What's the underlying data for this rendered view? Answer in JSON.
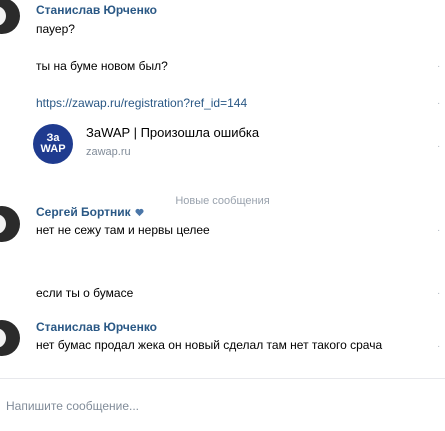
{
  "messages": {
    "m1": {
      "author": "Станислав Юрченко",
      "lines": [
        "пауер?",
        "ты на буме новом был?"
      ]
    },
    "link_url": "https://zawap.ru/registration?ref_id=144",
    "preview": {
      "logo_line1": "За",
      "logo_line2": "WAP",
      "title": "ЗаWAP | Произошла ошибка",
      "domain": "zawap.ru"
    },
    "divider": "Новые сообщения",
    "m2": {
      "author": "Сергей Бортник",
      "lines": [
        "нет не сежу там и нервы целее",
        "если ты о бумасе"
      ]
    },
    "m3": {
      "author": "Станислав Юрченко",
      "lines": [
        "нет бумас продал жека он новый сделал там нет такого срача"
      ]
    }
  },
  "input": {
    "placeholder": "Напишите сообщение..."
  },
  "colors": {
    "link": "#2a5885",
    "muted": "#818c99",
    "logo_bg": "#1f3b8f",
    "heart": "#4a76a8"
  },
  "icons": [
    "heart-icon"
  ]
}
